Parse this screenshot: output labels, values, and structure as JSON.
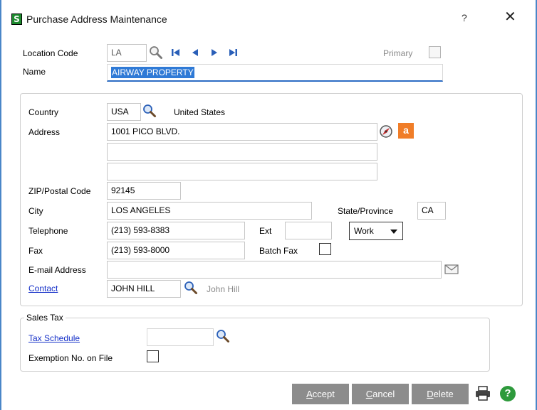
{
  "window": {
    "title": "Purchase Address Maintenance",
    "help_glyph": "?",
    "close_glyph": "✕",
    "app_icon_letter": "S"
  },
  "header": {
    "location_code_label": "Location Code",
    "location_code_value": "LA",
    "primary_label": "Primary",
    "name_label": "Name",
    "name_value": "AIRWAY PROPERTY"
  },
  "address": {
    "country_label": "Country",
    "country_value": "USA",
    "country_name": "United States",
    "address_label": "Address",
    "address_line1": "1001 PICO BLVD.",
    "address_line2": "",
    "address_line3": "",
    "amazon_letter": "a",
    "zip_label": "ZIP/Postal Code",
    "zip_value": "92145",
    "city_label": "City",
    "city_value": "LOS ANGELES",
    "state_label": "State/Province",
    "state_value": "CA",
    "telephone_label": "Telephone",
    "telephone_value": "(213) 593-8383",
    "ext_label": "Ext",
    "ext_value": "",
    "phone_type_value": "Work",
    "fax_label": "Fax",
    "fax_value": "(213) 593-8000",
    "batch_fax_label": "Batch Fax",
    "email_label": "E-mail Address",
    "email_value": "",
    "contact_label": "Contact",
    "contact_code": "JOHN HILL",
    "contact_name": "John Hill"
  },
  "sales_tax": {
    "section_label": "Sales Tax",
    "tax_schedule_label": "Tax Schedule",
    "tax_schedule_value": "",
    "exemption_label": "Exemption No. on File"
  },
  "footer": {
    "accept_label_hotkey": "A",
    "accept_label_rest": "ccept",
    "cancel_label_hotkey": "C",
    "cancel_label_rest": "ancel",
    "delete_label_hotkey": "D",
    "delete_label_rest": "elete",
    "help_glyph": "?"
  },
  "colors": {
    "window_border": "#4a86c8",
    "app_icon": "#1d8a2e",
    "selection": "#2f7ad6",
    "link": "#1530c8",
    "button": "#8c8c8c",
    "amazon": "#f07d28",
    "help": "#2e9a3c"
  }
}
